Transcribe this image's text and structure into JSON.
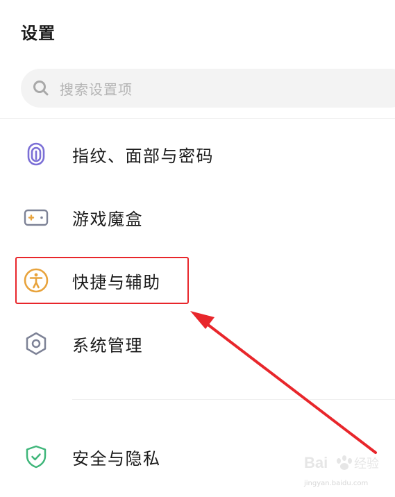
{
  "header": {
    "title": "设置"
  },
  "search": {
    "placeholder": "搜索设置项"
  },
  "menu": {
    "items": [
      {
        "label": "指纹、面部与密码",
        "icon": "fingerprint-icon",
        "color": "#7b6fd6"
      },
      {
        "label": "游戏魔盒",
        "icon": "gamepad-icon",
        "color": "#7d8296"
      },
      {
        "label": "快捷与辅助",
        "icon": "accessibility-icon",
        "color": "#e8a33c"
      },
      {
        "label": "系统管理",
        "icon": "hexagon-settings-icon",
        "color": "#7d8296"
      },
      {
        "label": "安全与隐私",
        "icon": "shield-check-icon",
        "color": "#3fb67a"
      }
    ]
  },
  "annotation": {
    "highlight_color": "#e8262b",
    "highlighted_item": "快捷与辅助"
  },
  "watermark": {
    "brand": "Baidu经验",
    "url": "jingyan.baidu.com"
  }
}
